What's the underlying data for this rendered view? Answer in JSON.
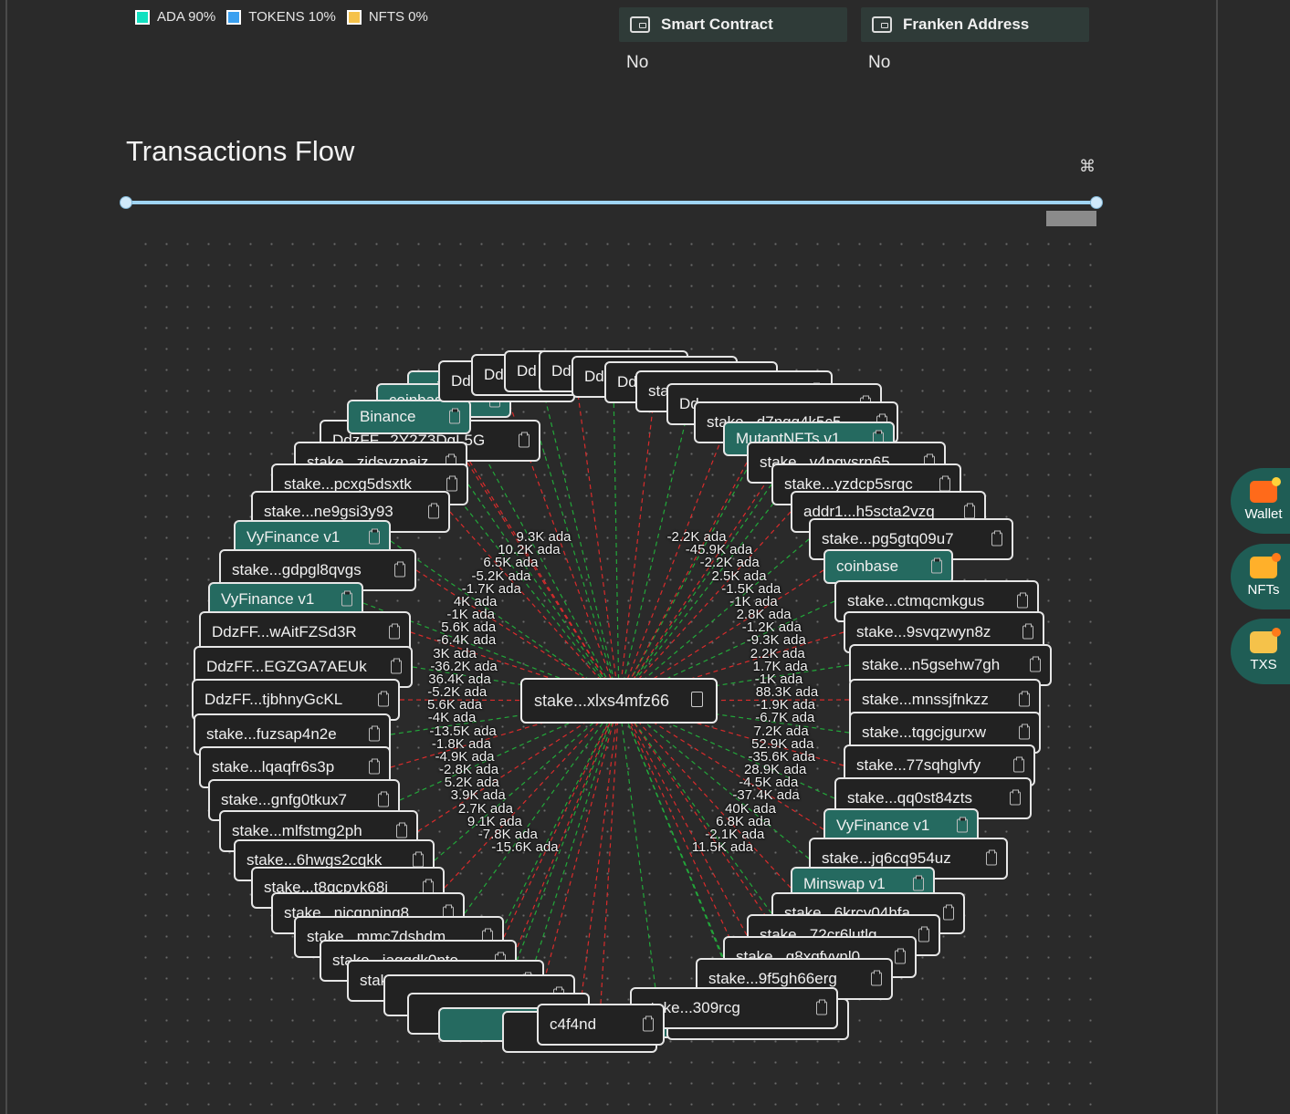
{
  "legend": [
    {
      "label": "ADA 90%",
      "color": "#12e0c0"
    },
    {
      "label": "TOKENS 10%",
      "color": "#3aa0f0"
    },
    {
      "label": "NFTS 0%",
      "color": "#f5c24a"
    }
  ],
  "header_cards": [
    {
      "title": "Smart Contract",
      "value": "No"
    },
    {
      "title": "Franken Address",
      "value": "No"
    }
  ],
  "section_title": "Transactions Flow",
  "fit_icon": "fit-view-icon",
  "center_node": {
    "label": "stake...xlxs4mfz66"
  },
  "edge_colors": {
    "incoming": "#22a83a",
    "outgoing": "#d92b2b"
  },
  "nodes_left": [
    "DdzFF...2Y2Z3DgL5G",
    "stake...zidsvzpajz",
    "stake...pcxg5dsxtk",
    "stake...ne9gsi3y93",
    "VyFinance v1",
    "stake...gdpgl8qvgs",
    "VyFinance v1",
    "DdzFF...wAitFZSd3R",
    "DdzFF...EGZGA7AEUk",
    "DdzFF...tjbhnyGcKL",
    "stake...fuzsap4n2e",
    "stake...lqaqfr6s3p",
    "stake...gnfg0tkux7",
    "stake...mlfstmg2ph",
    "stake...6hwgs2cqkk",
    "stake...t8gcpvk68j",
    "stake...nicqnnjng8",
    "stake...mmc7dshdm",
    "stake...jaqqdk0pto",
    "stake...5ujy0cm"
  ],
  "nodes_top": [
    "coinbase",
    "coinbase",
    "Binance",
    "Dd",
    "Dd",
    "Dd",
    "Dd",
    "Dd",
    "Dd",
    "sta",
    "Dd",
    "stake...d7ngg4k5c5",
    "MutantNFTs v1"
  ],
  "nodes_right": [
    "stake...v4pqvsrn65",
    "stake...yzdcp5srqc",
    "addr1...h5scta2vzq",
    "stake...pg5gtq09u7",
    "coinbase",
    "stake...ctmqcmkgus",
    "stake...9svqzwyn8z",
    "stake...n5gsehw7gh",
    "stake...mnssjfnkzz",
    "stake...tqgcjgurxw",
    "stake...77sqhglvfy",
    "stake...qq0st84zts",
    "VyFinance v1",
    "stake...jq6cq954uz",
    "Minswap v1",
    "stake...6krcv04hfa",
    "stake...72cr6lutlq",
    "stake...g8xqfvvnl0"
  ],
  "nodes_bottom": [
    "stake...9f5gh66erg",
    "stake...309rcg",
    "c4f4nd"
  ],
  "edge_labels_left": [
    "9.3K ada",
    "10.2K ada",
    "6.5K ada",
    "-5.2K ada",
    "-1.7K ada",
    "4K ada",
    "-1K ada",
    "5.6K ada",
    "-6.4K ada",
    "3K ada",
    "-36.2K ada",
    "36.4K ada",
    "-5.2K ada",
    "5.6K ada",
    "-4K ada",
    "-13.5K ada",
    "-1.8K ada",
    "-4.9K ada",
    "-2.8K ada",
    "5.2K ada",
    "3.9K ada",
    "2.7K ada",
    "9.1K ada",
    "-7.8K ada",
    "-15.6K ada"
  ],
  "edge_labels_right": [
    "-2.2K ada",
    "-45.9K ada",
    "-2.2K ada",
    "2.5K ada",
    "-1.5K ada",
    "-1K ada",
    "2.8K ada",
    "-1.2K ada",
    "-9.3K ada",
    "2.2K ada",
    "1.7K ada",
    "-1K ada",
    "88.3K ada",
    "-1.9K ada",
    "-6.7K ada",
    "7.2K ada",
    "52.9K ada",
    "-35.6K ada",
    "28.9K ada",
    "-4.5K ada",
    "-37.4K ada",
    "40K ada",
    "6.8K ada",
    "-2.1K ada",
    "11.5K ada"
  ],
  "sidebar": [
    {
      "label": "Wallet",
      "icon": "wallet-icon"
    },
    {
      "label": "NFTs",
      "icon": "nfts-icon"
    },
    {
      "label": "TXS",
      "icon": "txs-icon"
    }
  ]
}
